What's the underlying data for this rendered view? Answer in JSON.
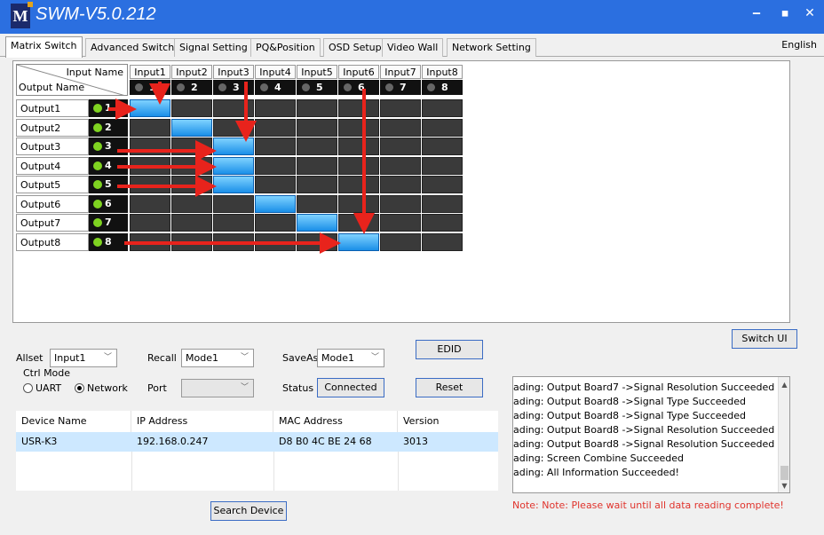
{
  "app": {
    "title": "SWM-V5.0.212",
    "logo_letter": "M"
  },
  "window": {
    "minimize": "‒",
    "maximize": "◼",
    "close": "✕"
  },
  "tabs": [
    {
      "label": "Matrix Switch"
    },
    {
      "label": "Advanced Switch"
    },
    {
      "label": "Signal Setting"
    },
    {
      "label": "PQ&Position"
    },
    {
      "label": "OSD Setup"
    },
    {
      "label": "Video Wall"
    },
    {
      "label": "Network Setting"
    }
  ],
  "language": "English",
  "matrix": {
    "input_header": "Input Name",
    "output_header": "Output Name",
    "inputs": [
      {
        "name": "Input1",
        "num": "1"
      },
      {
        "name": "Input2",
        "num": "2"
      },
      {
        "name": "Input3",
        "num": "3"
      },
      {
        "name": "Input4",
        "num": "4"
      },
      {
        "name": "Input5",
        "num": "5"
      },
      {
        "name": "Input6",
        "num": "6"
      },
      {
        "name": "Input7",
        "num": "7"
      },
      {
        "name": "Input8",
        "num": "8"
      }
    ],
    "outputs": [
      {
        "name": "Output1",
        "num": "1",
        "selected_input": 1
      },
      {
        "name": "Output2",
        "num": "2",
        "selected_input": 2
      },
      {
        "name": "Output3",
        "num": "3",
        "selected_input": 3
      },
      {
        "name": "Output4",
        "num": "4",
        "selected_input": 3
      },
      {
        "name": "Output5",
        "num": "5",
        "selected_input": 3
      },
      {
        "name": "Output6",
        "num": "6",
        "selected_input": 4
      },
      {
        "name": "Output7",
        "num": "7",
        "selected_input": 5
      },
      {
        "name": "Output8",
        "num": "8",
        "selected_input": 6
      }
    ],
    "arrow_color": "#e8231c",
    "active_color": "#1a8fe8"
  },
  "controls": {
    "switch_ui": "Switch UI",
    "allset_label": "Allset",
    "allset_value": "Input1",
    "recall_label": "Recall",
    "recall_value": "Mode1",
    "saveas_label": "SaveAs",
    "saveas_value": "Mode1",
    "edid": "EDID",
    "ctrl_mode_label": "Ctrl Mode",
    "uart_label": "UART",
    "network_label": "Network",
    "port_label": "Port",
    "port_value": "",
    "status_label": "Status",
    "status_value": "Connected",
    "reset": "Reset",
    "search_device": "Search Device"
  },
  "devices": {
    "headers": [
      "Device Name",
      "IP Address",
      "MAC Address",
      "Version"
    ],
    "rows": [
      [
        "USR-K3",
        "192.168.0.247",
        "D8 B0 4C BE 24 68",
        "3013"
      ]
    ]
  },
  "log": [
    "ading: Output Board7 ->Signal Resolution Succeeded",
    "ading: Output Board8 ->Signal Type Succeeded",
    "ading: Output Board8 ->Signal Type Succeeded",
    "ading: Output Board8 ->Signal Resolution Succeeded",
    "ading: Output Board8 ->Signal Resolution Succeeded",
    "ading: Screen Combine Succeeded",
    "ading: All Information Succeeded!"
  ],
  "note": "Note: Note: Please wait until all data reading complete!"
}
